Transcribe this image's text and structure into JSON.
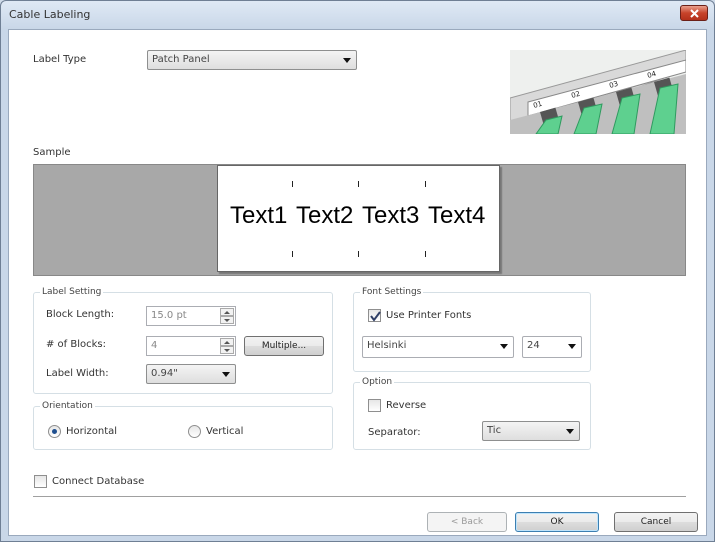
{
  "window": {
    "title": "Cable Labeling"
  },
  "label_type": {
    "label": "Label Type",
    "value": "Patch Panel"
  },
  "preview_ports": [
    "01",
    "02",
    "03",
    "04"
  ],
  "sample": {
    "label": "Sample",
    "texts": [
      "Text1",
      "Text2",
      "Text3",
      "Text4"
    ]
  },
  "label_setting": {
    "title": "Label Setting",
    "block_length": {
      "label": "Block Length:",
      "value": "15.0 pt"
    },
    "num_blocks": {
      "label": "# of Blocks:",
      "value": "4"
    },
    "multiple_button": "Multiple...",
    "label_width": {
      "label": "Label Width:",
      "value": "0.94\""
    }
  },
  "orientation": {
    "title": "Orientation",
    "horizontal": "Horizontal",
    "vertical": "Vertical",
    "selected": "horizontal"
  },
  "font_settings": {
    "title": "Font Settings",
    "use_printer_fonts": "Use Printer Fonts",
    "use_printer_fonts_checked": true,
    "font": "Helsinki",
    "size": "24"
  },
  "option": {
    "title": "Option",
    "reverse": "Reverse",
    "reverse_checked": false,
    "separator_label": "Separator:",
    "separator_value": "Tic"
  },
  "connect_database": {
    "label": "Connect Database",
    "checked": false
  },
  "buttons": {
    "back": "< Back",
    "ok": "OK",
    "cancel": "Cancel"
  },
  "colors": {
    "accent": "#3c7fb1",
    "cable": "#5ed08f",
    "sample_bg": "#a8a8a8"
  }
}
